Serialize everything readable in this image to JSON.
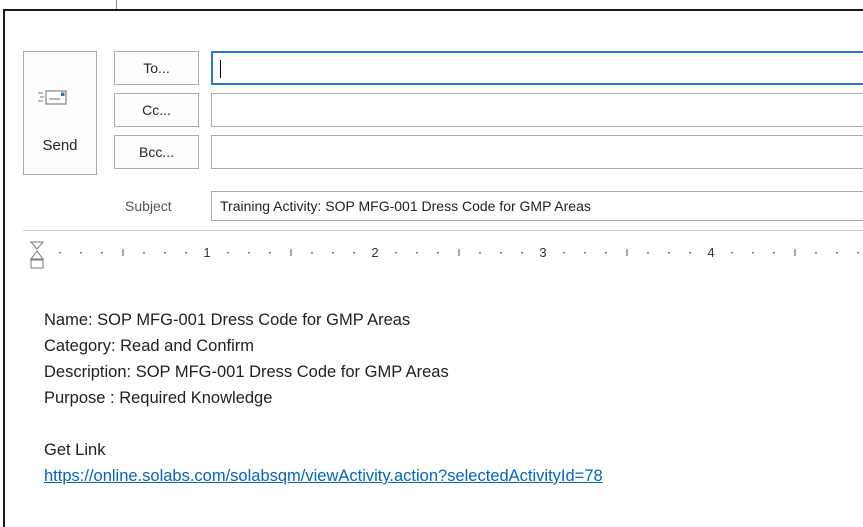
{
  "compose": {
    "send_label": "Send",
    "to_label": "To...",
    "cc_label": "Cc...",
    "bcc_label": "Bcc...",
    "to_value": "",
    "cc_value": "",
    "bcc_value": "",
    "subject_label": "Subject",
    "subject_value": "Training Activity: SOP MFG-001 Dress Code for GMP Areas"
  },
  "ruler": {
    "numbers": [
      "1",
      "2",
      "3",
      "4"
    ]
  },
  "body": {
    "name_line": "Name: SOP MFG-001 Dress Code for GMP Areas",
    "category_line": "Category: Read and Confirm",
    "description_line": "Description: SOP MFG-001 Dress Code for GMP Areas",
    "purpose_line": "Purpose : Required Knowledge",
    "get_link_label": "Get Link",
    "link_url": "https://online.solabs.com/solabsqm/viewActivity.action?selectedActivityId=78"
  },
  "colors": {
    "link": "#0563c1",
    "focus_border": "#2b79d6",
    "envelope": "#2e75b6"
  }
}
